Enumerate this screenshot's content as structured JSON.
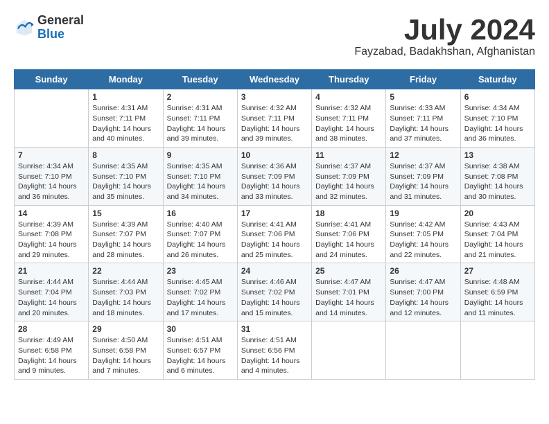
{
  "header": {
    "logo_general": "General",
    "logo_blue": "Blue",
    "month_title": "July 2024",
    "location": "Fayzabad, Badakhshan, Afghanistan"
  },
  "weekdays": [
    "Sunday",
    "Monday",
    "Tuesday",
    "Wednesday",
    "Thursday",
    "Friday",
    "Saturday"
  ],
  "weeks": [
    [
      {
        "day": "",
        "sunrise": "",
        "sunset": "",
        "daylight": ""
      },
      {
        "day": "1",
        "sunrise": "Sunrise: 4:31 AM",
        "sunset": "Sunset: 7:11 PM",
        "daylight": "Daylight: 14 hours and 40 minutes."
      },
      {
        "day": "2",
        "sunrise": "Sunrise: 4:31 AM",
        "sunset": "Sunset: 7:11 PM",
        "daylight": "Daylight: 14 hours and 39 minutes."
      },
      {
        "day": "3",
        "sunrise": "Sunrise: 4:32 AM",
        "sunset": "Sunset: 7:11 PM",
        "daylight": "Daylight: 14 hours and 39 minutes."
      },
      {
        "day": "4",
        "sunrise": "Sunrise: 4:32 AM",
        "sunset": "Sunset: 7:11 PM",
        "daylight": "Daylight: 14 hours and 38 minutes."
      },
      {
        "day": "5",
        "sunrise": "Sunrise: 4:33 AM",
        "sunset": "Sunset: 7:11 PM",
        "daylight": "Daylight: 14 hours and 37 minutes."
      },
      {
        "day": "6",
        "sunrise": "Sunrise: 4:34 AM",
        "sunset": "Sunset: 7:10 PM",
        "daylight": "Daylight: 14 hours and 36 minutes."
      }
    ],
    [
      {
        "day": "7",
        "sunrise": "Sunrise: 4:34 AM",
        "sunset": "Sunset: 7:10 PM",
        "daylight": "Daylight: 14 hours and 36 minutes."
      },
      {
        "day": "8",
        "sunrise": "Sunrise: 4:35 AM",
        "sunset": "Sunset: 7:10 PM",
        "daylight": "Daylight: 14 hours and 35 minutes."
      },
      {
        "day": "9",
        "sunrise": "Sunrise: 4:35 AM",
        "sunset": "Sunset: 7:10 PM",
        "daylight": "Daylight: 14 hours and 34 minutes."
      },
      {
        "day": "10",
        "sunrise": "Sunrise: 4:36 AM",
        "sunset": "Sunset: 7:09 PM",
        "daylight": "Daylight: 14 hours and 33 minutes."
      },
      {
        "day": "11",
        "sunrise": "Sunrise: 4:37 AM",
        "sunset": "Sunset: 7:09 PM",
        "daylight": "Daylight: 14 hours and 32 minutes."
      },
      {
        "day": "12",
        "sunrise": "Sunrise: 4:37 AM",
        "sunset": "Sunset: 7:09 PM",
        "daylight": "Daylight: 14 hours and 31 minutes."
      },
      {
        "day": "13",
        "sunrise": "Sunrise: 4:38 AM",
        "sunset": "Sunset: 7:08 PM",
        "daylight": "Daylight: 14 hours and 30 minutes."
      }
    ],
    [
      {
        "day": "14",
        "sunrise": "Sunrise: 4:39 AM",
        "sunset": "Sunset: 7:08 PM",
        "daylight": "Daylight: 14 hours and 29 minutes."
      },
      {
        "day": "15",
        "sunrise": "Sunrise: 4:39 AM",
        "sunset": "Sunset: 7:07 PM",
        "daylight": "Daylight: 14 hours and 28 minutes."
      },
      {
        "day": "16",
        "sunrise": "Sunrise: 4:40 AM",
        "sunset": "Sunset: 7:07 PM",
        "daylight": "Daylight: 14 hours and 26 minutes."
      },
      {
        "day": "17",
        "sunrise": "Sunrise: 4:41 AM",
        "sunset": "Sunset: 7:06 PM",
        "daylight": "Daylight: 14 hours and 25 minutes."
      },
      {
        "day": "18",
        "sunrise": "Sunrise: 4:41 AM",
        "sunset": "Sunset: 7:06 PM",
        "daylight": "Daylight: 14 hours and 24 minutes."
      },
      {
        "day": "19",
        "sunrise": "Sunrise: 4:42 AM",
        "sunset": "Sunset: 7:05 PM",
        "daylight": "Daylight: 14 hours and 22 minutes."
      },
      {
        "day": "20",
        "sunrise": "Sunrise: 4:43 AM",
        "sunset": "Sunset: 7:04 PM",
        "daylight": "Daylight: 14 hours and 21 minutes."
      }
    ],
    [
      {
        "day": "21",
        "sunrise": "Sunrise: 4:44 AM",
        "sunset": "Sunset: 7:04 PM",
        "daylight": "Daylight: 14 hours and 20 minutes."
      },
      {
        "day": "22",
        "sunrise": "Sunrise: 4:44 AM",
        "sunset": "Sunset: 7:03 PM",
        "daylight": "Daylight: 14 hours and 18 minutes."
      },
      {
        "day": "23",
        "sunrise": "Sunrise: 4:45 AM",
        "sunset": "Sunset: 7:02 PM",
        "daylight": "Daylight: 14 hours and 17 minutes."
      },
      {
        "day": "24",
        "sunrise": "Sunrise: 4:46 AM",
        "sunset": "Sunset: 7:02 PM",
        "daylight": "Daylight: 14 hours and 15 minutes."
      },
      {
        "day": "25",
        "sunrise": "Sunrise: 4:47 AM",
        "sunset": "Sunset: 7:01 PM",
        "daylight": "Daylight: 14 hours and 14 minutes."
      },
      {
        "day": "26",
        "sunrise": "Sunrise: 4:47 AM",
        "sunset": "Sunset: 7:00 PM",
        "daylight": "Daylight: 14 hours and 12 minutes."
      },
      {
        "day": "27",
        "sunrise": "Sunrise: 4:48 AM",
        "sunset": "Sunset: 6:59 PM",
        "daylight": "Daylight: 14 hours and 11 minutes."
      }
    ],
    [
      {
        "day": "28",
        "sunrise": "Sunrise: 4:49 AM",
        "sunset": "Sunset: 6:58 PM",
        "daylight": "Daylight: 14 hours and 9 minutes."
      },
      {
        "day": "29",
        "sunrise": "Sunrise: 4:50 AM",
        "sunset": "Sunset: 6:58 PM",
        "daylight": "Daylight: 14 hours and 7 minutes."
      },
      {
        "day": "30",
        "sunrise": "Sunrise: 4:51 AM",
        "sunset": "Sunset: 6:57 PM",
        "daylight": "Daylight: 14 hours and 6 minutes."
      },
      {
        "day": "31",
        "sunrise": "Sunrise: 4:51 AM",
        "sunset": "Sunset: 6:56 PM",
        "daylight": "Daylight: 14 hours and 4 minutes."
      },
      {
        "day": "",
        "sunrise": "",
        "sunset": "",
        "daylight": ""
      },
      {
        "day": "",
        "sunrise": "",
        "sunset": "",
        "daylight": ""
      },
      {
        "day": "",
        "sunrise": "",
        "sunset": "",
        "daylight": ""
      }
    ]
  ]
}
